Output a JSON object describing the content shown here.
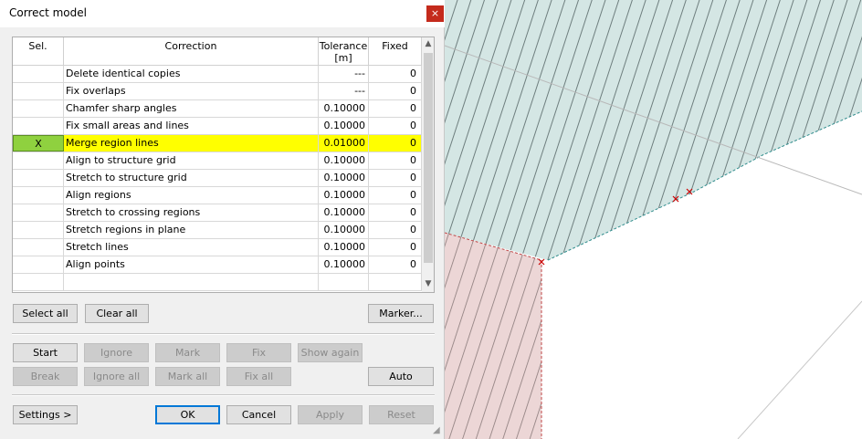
{
  "dialog": {
    "title": "Correct model",
    "close_label": "×"
  },
  "grid": {
    "headers": {
      "sel": "Sel.",
      "correction": "Correction",
      "tolerance": "Tolerance [m]",
      "fixed": "Fixed"
    },
    "rows": [
      {
        "sel": "",
        "correction": "Delete identical copies",
        "tolerance": "---",
        "fixed": "0"
      },
      {
        "sel": "",
        "correction": "Fix overlaps",
        "tolerance": "---",
        "fixed": "0"
      },
      {
        "sel": "",
        "correction": "Chamfer sharp angles",
        "tolerance": "0.10000",
        "fixed": "0"
      },
      {
        "sel": "",
        "correction": "Fix small areas and lines",
        "tolerance": "0.10000",
        "fixed": "0"
      },
      {
        "sel": "X",
        "correction": "Merge region lines",
        "tolerance": "0.01000",
        "fixed": "0"
      },
      {
        "sel": "",
        "correction": "Align to structure grid",
        "tolerance": "0.10000",
        "fixed": "0"
      },
      {
        "sel": "",
        "correction": "Stretch to structure grid",
        "tolerance": "0.10000",
        "fixed": "0"
      },
      {
        "sel": "",
        "correction": "Align regions",
        "tolerance": "0.10000",
        "fixed": "0"
      },
      {
        "sel": "",
        "correction": "Stretch to crossing regions",
        "tolerance": "0.10000",
        "fixed": "0"
      },
      {
        "sel": "",
        "correction": "Stretch regions in plane",
        "tolerance": "0.10000",
        "fixed": "0"
      },
      {
        "sel": "",
        "correction": "Stretch lines",
        "tolerance": "0.10000",
        "fixed": "0"
      },
      {
        "sel": "",
        "correction": "Align points",
        "tolerance": "0.10000",
        "fixed": "0"
      },
      {
        "sel": "",
        "correction": "",
        "tolerance": "",
        "fixed": ""
      }
    ]
  },
  "buttons": {
    "select_all": "Select all",
    "clear_all": "Clear all",
    "marker": "Marker...",
    "start": "Start",
    "ignore": "Ignore",
    "mark": "Mark",
    "fix": "Fix",
    "show_again": "Show again",
    "break": "Break",
    "ignore_all": "Ignore all",
    "mark_all": "Mark all",
    "fix_all": "Fix all",
    "auto": "Auto",
    "settings": "Settings >",
    "ok": "OK",
    "cancel": "Cancel",
    "apply": "Apply",
    "reset": "Reset"
  },
  "colors": {
    "highlight_row": "#ffff00",
    "selected_cell": "#8fd13f",
    "region_teal": "#d4e6e4",
    "region_pink": "#ecd6d6",
    "hatch": "#6e7e7e",
    "error_marker": "#cc0000"
  }
}
